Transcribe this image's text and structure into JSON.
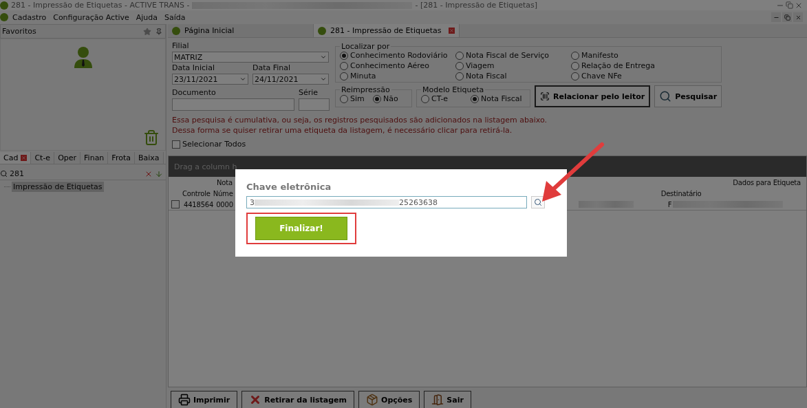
{
  "window": {
    "title_left": "281 - Impressão de Etiquetas - ACTIVE TRANS -",
    "title_right": "- [281 - Impressão de Etiquetas]"
  },
  "menu": [
    "Cadastro",
    "Configuração Active",
    "Ajuda",
    "Saída"
  ],
  "favorites": {
    "title": "Favoritos"
  },
  "left_tabs": [
    {
      "label": "Cad",
      "selected": true
    },
    {
      "label": "Ct-e",
      "selected": false
    },
    {
      "label": "Oper",
      "selected": false
    },
    {
      "label": "Finan",
      "selected": false
    },
    {
      "label": "Frota",
      "selected": false
    },
    {
      "label": "Baixa",
      "selected": false
    }
  ],
  "left_search": {
    "value": "281"
  },
  "tree": [
    {
      "label": "Impressão de Etiquetas",
      "selected": true
    }
  ],
  "doc_tabs": [
    {
      "label": "Página Inicial",
      "selected": false
    },
    {
      "label": "281 - Impressão de Etiquetas",
      "selected": true
    }
  ],
  "form": {
    "filial": {
      "label": "Filial",
      "value": "MATRIZ"
    },
    "data_inicial": {
      "label": "Data Inicial",
      "value": "23/11/2021"
    },
    "data_final": {
      "label": "Data Final",
      "value": "24/11/2021"
    },
    "documento": {
      "label": "Documento"
    },
    "serie": {
      "label": "Série"
    }
  },
  "localizar_por": {
    "title": "Localizar por",
    "options": [
      {
        "label": "Conhecimento Rodoviário",
        "selected": true
      },
      {
        "label": "Nota Fiscal de Serviço",
        "selected": false
      },
      {
        "label": "Manifesto",
        "selected": false
      },
      {
        "label": "Conhecimento Aéreo",
        "selected": false
      },
      {
        "label": "Viagem",
        "selected": false
      },
      {
        "label": "Relação de Entrega",
        "selected": false
      },
      {
        "label": "Minuta",
        "selected": false
      },
      {
        "label": "Nota Fiscal",
        "selected": false
      },
      {
        "label": "Chave NFe",
        "selected": false
      }
    ]
  },
  "reimpressao": {
    "title": "Reimpressão",
    "options": [
      {
        "label": "Sim",
        "selected": false
      },
      {
        "label": "Não",
        "selected": true
      }
    ]
  },
  "modelo_etiqueta": {
    "title": "Modelo Etiqueta",
    "options": [
      {
        "label": "CT-e",
        "selected": false
      },
      {
        "label": "Nota Fiscal",
        "selected": true
      }
    ]
  },
  "actions": [
    "Relacionar pelo leitor",
    "Pesquisar"
  ],
  "notice": [
    "Essa pesquisa é cumulativa, ou seja, os registros pesquisados são adicionados na listagem abaixo.",
    "Dessa forma se quiser retirar uma etiqueta da listagem, é necessário clicar para retirá-la."
  ],
  "select_all": {
    "label": "Selecionar Todos",
    "checked": false
  },
  "grid": {
    "group_hint": "Drag a column h",
    "group_headers": [
      "Nota",
      "Dados para Etiqueta"
    ],
    "columns": [
      "Controle",
      "Núme",
      "Destinatário"
    ],
    "rows": [
      {
        "checked": false,
        "cells": [
          "4418564",
          "0000",
          "F"
        ]
      }
    ]
  },
  "bottom_buttons": [
    "Imprimir",
    "Retirar da listagem",
    "Opções",
    "Sair"
  ],
  "dialog": {
    "title": "Chave eletrônica",
    "value_start": "3",
    "value_end": "25263638",
    "button": "Finalizar!"
  }
}
